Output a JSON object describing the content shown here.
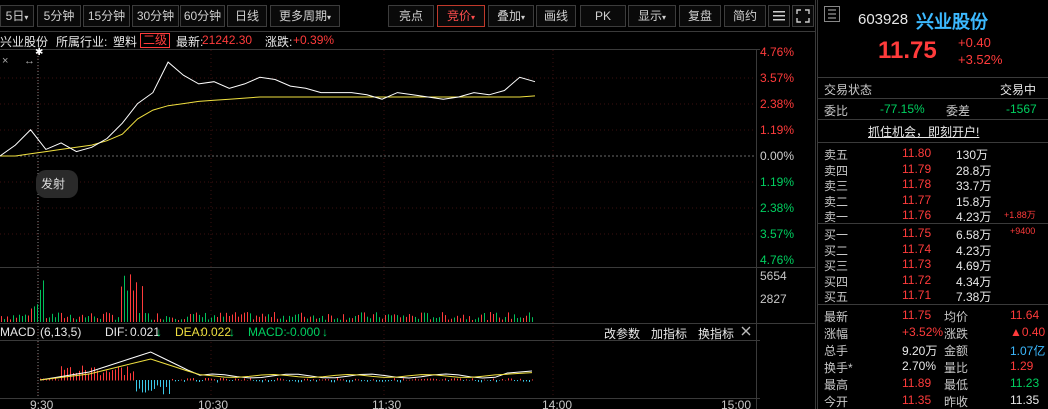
{
  "toolbar": {
    "tabs": [
      "5日",
      "5分钟",
      "15分钟",
      "30分钟",
      "60分钟",
      "日线",
      "更多周期"
    ],
    "buttons": [
      "亮点",
      "竞价",
      "叠加",
      "画线",
      "PK",
      "显示",
      "复盘",
      "简约"
    ]
  },
  "info": {
    "name": "兴业股份",
    "industry_label": "所属行业:",
    "industry": "塑料",
    "level": "二级",
    "latest_label": "最新:",
    "latest": "21242.30",
    "change_label": "涨跌:",
    "change": "+0.39%",
    "marker": "发射"
  },
  "price_axis": {
    "up": [
      "4.76%",
      "3.57%",
      "2.38%",
      "1.19%"
    ],
    "zero": "0.00%",
    "down": [
      "1.19%",
      "2.38%",
      "3.57%",
      "4.76%"
    ]
  },
  "volume_axis": [
    "5654",
    "2827"
  ],
  "macd": {
    "title": "MACD",
    "params": "(6,13,5)",
    "dif_label": "DIF:",
    "dif": "0.021",
    "dea_label": "DEA:",
    "dea": "0.022",
    "macd_label": "MACD:",
    "macd": "-0.000",
    "buttons": [
      "改参数",
      "加指标",
      "换指标"
    ]
  },
  "time_axis": [
    "9:30",
    "10:30",
    "11:30",
    "14:00",
    "15:00"
  ],
  "chart_data": {
    "type": "line",
    "series": [
      {
        "values": [
          0.0,
          0.5,
          1.2,
          0.3,
          0.6,
          0.2,
          0.4,
          0.8,
          1.5,
          2.4,
          2.9,
          4.3,
          3.7,
          3.3,
          3.4,
          3.1,
          3.3,
          3.6,
          3.5,
          3.2,
          3.1,
          2.9,
          2.9,
          2.9,
          2.8,
          2.6,
          2.9,
          2.8,
          2.7,
          2.6,
          2.7,
          2.9,
          2.8,
          3.0,
          3.6,
          3.4
        ]
      },
      {
        "values": [
          0.0,
          0.0,
          0.1,
          0.2,
          0.3,
          0.4,
          0.5,
          0.7,
          1.0,
          1.7,
          2.1,
          2.3,
          2.4,
          2.5,
          2.55,
          2.6,
          2.65,
          2.7,
          2.7,
          2.7,
          2.7,
          2.7,
          2.7,
          2.7,
          2.7,
          2.7,
          2.7,
          2.7,
          2.7,
          2.7,
          2.7,
          2.7,
          2.7,
          2.7,
          2.7,
          2.75
        ]
      }
    ],
    "ylim": [
      -4.76,
      4.76
    ]
  },
  "quote": {
    "code": "603928",
    "name": "兴业股份",
    "price": "11.75",
    "change": "+0.40",
    "pct": "+3.52%",
    "status_label": "交易状态",
    "status": "交易中",
    "weibi_label": "委比",
    "weibi": "-77.15%",
    "weicha_label": "委差",
    "weicha": "-1567",
    "promo": "抓住机会，即刻开户!"
  },
  "sells": [
    {
      "label": "卖五",
      "price": "11.80",
      "vol": "130万",
      "extra": ""
    },
    {
      "label": "卖四",
      "price": "11.79",
      "vol": "28.8万",
      "extra": ""
    },
    {
      "label": "卖三",
      "price": "11.78",
      "vol": "33.7万",
      "extra": ""
    },
    {
      "label": "卖二",
      "price": "11.77",
      "vol": "15.8万",
      "extra": ""
    },
    {
      "label": "卖一",
      "price": "11.76",
      "vol": "4.23万",
      "extra": "+1.88万"
    }
  ],
  "buys": [
    {
      "label": "买一",
      "price": "11.75",
      "vol": "6.58万",
      "extra": "+9400"
    },
    {
      "label": "买二",
      "price": "11.74",
      "vol": "4.23万",
      "extra": ""
    },
    {
      "label": "买三",
      "price": "11.73",
      "vol": "4.69万",
      "extra": ""
    },
    {
      "label": "买四",
      "price": "11.72",
      "vol": "4.34万",
      "extra": ""
    },
    {
      "label": "买五",
      "price": "11.71",
      "vol": "7.38万",
      "extra": ""
    }
  ],
  "stats": [
    {
      "l1": "最新",
      "v1": "11.75",
      "l2": "均价",
      "v2": "11.64"
    },
    {
      "l1": "涨幅",
      "v1": "+3.52%",
      "l2": "涨跌",
      "v2": "▲0.40"
    },
    {
      "l1": "总手",
      "v1": "9.20万",
      "l2": "金额",
      "v2": "1.07亿"
    },
    {
      "l1": "换手*",
      "v1": "2.70%",
      "l2": "量比",
      "v2": "1.29"
    },
    {
      "l1": "最高",
      "v1": "11.89",
      "l2": "最低",
      "v2": "11.23"
    },
    {
      "l1": "今开",
      "v1": "11.35",
      "l2": "昨收",
      "v2": "11.35"
    }
  ],
  "colors": {
    "up": "#ff3b3b",
    "down": "#00d060",
    "price_line": "#ffffff",
    "avg_line": "#f0e040",
    "accent": "#3cb9ff"
  },
  "icons": {
    "menu": "menu-icon",
    "fullscreen": "fullscreen-icon",
    "close": "close-icon",
    "expand": "expand-icon"
  }
}
